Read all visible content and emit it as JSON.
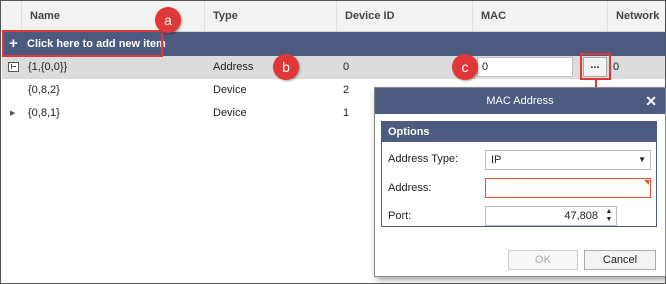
{
  "grid": {
    "columns": [
      "Name",
      "Type",
      "Device ID",
      "MAC",
      "Network"
    ],
    "add_row_label": "Click here to add new item",
    "rows": [
      {
        "name": "{1,{0,0}}",
        "type": "Address",
        "device_id": "0",
        "mac": "0",
        "network": "0"
      },
      {
        "name": "{0,8,2}",
        "type": "Device",
        "device_id": "2"
      },
      {
        "name": "{0,8,1}",
        "type": "Device",
        "device_id": "1"
      }
    ],
    "mac_button_label": "..."
  },
  "callouts": [
    "a",
    "b",
    "c"
  ],
  "dialog": {
    "title": "MAC Address",
    "close_glyph": "✕",
    "options_header": "Options",
    "address_type_label": "Address Type:",
    "address_type_value": "IP",
    "address_label": "Address:",
    "address_value": "",
    "port_label": "Port:",
    "port_value": "47,808",
    "ok_label": "OK",
    "cancel_label": "Cancel"
  },
  "colors": {
    "header_bar": "#4d5a80",
    "callout": "#e03838"
  }
}
